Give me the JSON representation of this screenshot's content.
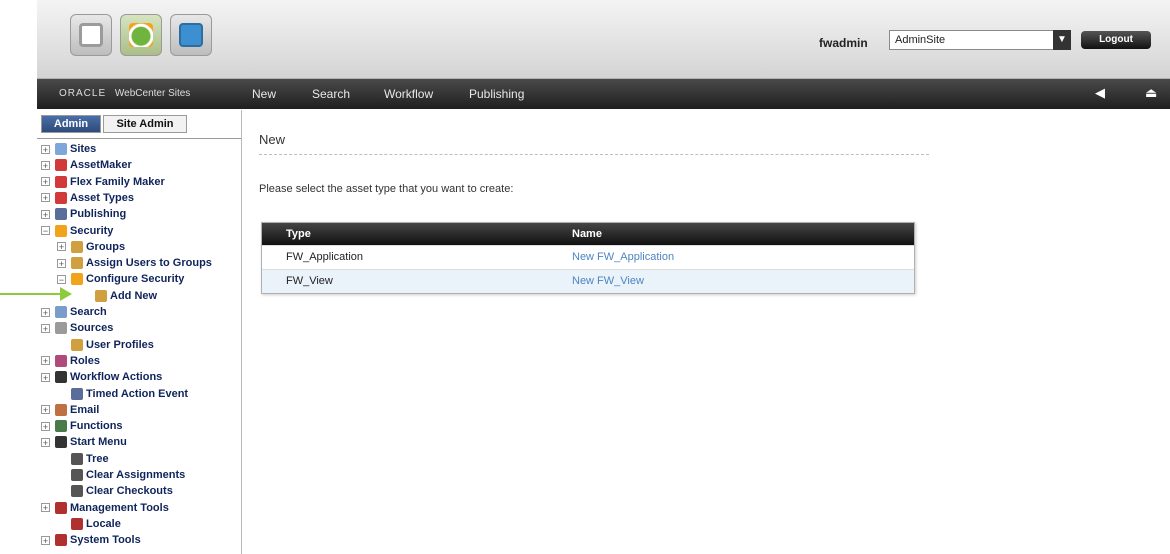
{
  "header": {
    "username": "fwadmin",
    "site_selector_value": "AdminSite",
    "logout_label": "Logout"
  },
  "navbar": {
    "brand_oracle": "ORACLE",
    "brand_product": "WebCenter Sites",
    "menu": [
      "New",
      "Search",
      "Workflow",
      "Publishing"
    ]
  },
  "left_panel": {
    "tabs": [
      "Admin",
      "Site Admin"
    ],
    "tree": [
      {
        "label": "Sites",
        "expander": "+",
        "icon_color": "#7fa6d8"
      },
      {
        "label": "AssetMaker",
        "expander": "+",
        "icon_color": "#d23a3a"
      },
      {
        "label": "Flex Family Maker",
        "expander": "+",
        "icon_color": "#d23a3a"
      },
      {
        "label": "Asset Types",
        "expander": "+",
        "icon_color": "#d23a3a"
      },
      {
        "label": "Publishing",
        "expander": "+",
        "icon_color": "#5a6d9a"
      },
      {
        "label": "Security",
        "expander": "−",
        "icon_color": "#f2a31b"
      },
      {
        "label": "Groups",
        "expander": "+",
        "icon_color": "#d0a040"
      },
      {
        "label": "Assign Users to Groups",
        "expander": "+",
        "icon_color": "#d0a040"
      },
      {
        "label": "Configure Security",
        "expander": "−",
        "icon_color": "#f2a31b"
      },
      {
        "label": "Add New",
        "expander": "",
        "icon_color": "#d0a040"
      },
      {
        "label": "Search",
        "expander": "+",
        "icon_color": "#7a9cc8"
      },
      {
        "label": "Sources",
        "expander": "+",
        "icon_color": "#9a9a9a"
      },
      {
        "label": "User Profiles",
        "expander": "",
        "icon_color": "#d0a040"
      },
      {
        "label": "Roles",
        "expander": "+",
        "icon_color": "#b04a7a"
      },
      {
        "label": "Workflow Actions",
        "expander": "+",
        "icon_color": "#333333"
      },
      {
        "label": "Timed Action Event",
        "expander": "",
        "icon_color": "#5a6d9a"
      },
      {
        "label": "Email",
        "expander": "+",
        "icon_color": "#c07040"
      },
      {
        "label": "Functions",
        "expander": "+",
        "icon_color": "#4a7a4a"
      },
      {
        "label": "Start Menu",
        "expander": "+",
        "icon_color": "#333333"
      },
      {
        "label": "Tree",
        "expander": "",
        "icon_color": "#555555"
      },
      {
        "label": "Clear Assignments",
        "expander": "",
        "icon_color": "#555555"
      },
      {
        "label": "Clear Checkouts",
        "expander": "",
        "icon_color": "#555555"
      },
      {
        "label": "Management Tools",
        "expander": "+",
        "icon_color": "#b03030"
      },
      {
        "label": "Locale",
        "expander": "",
        "icon_color": "#b03030"
      },
      {
        "label": "System Tools",
        "expander": "+",
        "icon_color": "#b03030"
      }
    ]
  },
  "main": {
    "title": "New",
    "instruction": "Please select the asset type that you want to create:",
    "table": {
      "headers": [
        "Type",
        "Name"
      ],
      "rows": [
        {
          "type": "FW_Application",
          "name": "New FW_Application"
        },
        {
          "type": "FW_View",
          "name": "New FW_View"
        }
      ]
    }
  }
}
